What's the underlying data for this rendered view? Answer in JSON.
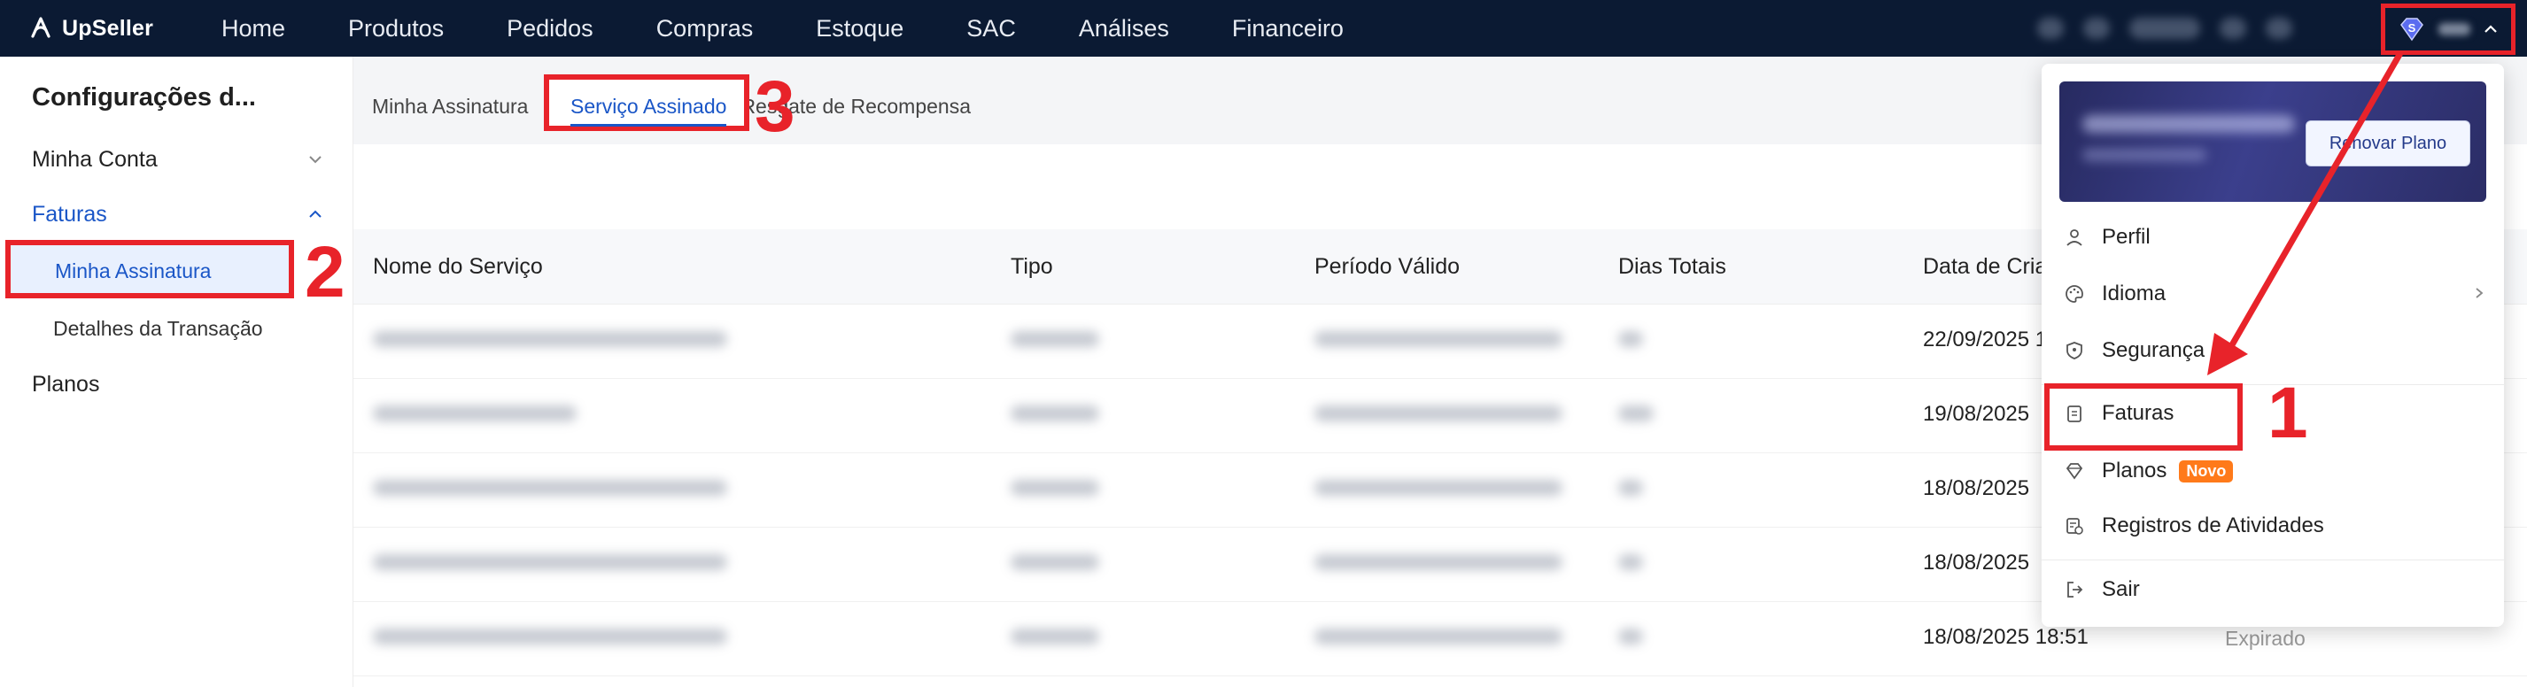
{
  "app": {
    "logo_text": "UpSeller"
  },
  "nav": [
    "Home",
    "Produtos",
    "Pedidos",
    "Compras",
    "Estoque",
    "SAC",
    "Análises",
    "Financeiro"
  ],
  "sidebar": {
    "title": "Configurações d...",
    "items": [
      {
        "label": "Minha Conta"
      },
      {
        "label": "Faturas"
      },
      {
        "label": "Minha Assinatura"
      },
      {
        "label": "Detalhes da Transação"
      },
      {
        "label": "Planos"
      }
    ]
  },
  "tabs": [
    "Minha Assinatura",
    "Serviço Assinado",
    "Resgate de Recompensa"
  ],
  "table": {
    "columns": [
      "Nome do Serviço",
      "Tipo",
      "Período Válido",
      "Dias Totais",
      "Data de Cria"
    ],
    "rows": [
      {
        "date": "22/09/2025 1"
      },
      {
        "date": "19/08/2025"
      },
      {
        "date": "18/08/2025"
      },
      {
        "date": "18/08/2025"
      },
      {
        "date": "18/08/2025 18:51",
        "status": "Expirado"
      }
    ]
  },
  "dropdown": {
    "renew_label": "Renovar Plano",
    "items": [
      "Perfil",
      "Idioma",
      "Segurança",
      "Faturas",
      "Planos",
      "Registros de Atividades",
      "Sair"
    ],
    "new_badge": "Novo"
  },
  "annotations": [
    "1",
    "2",
    "3"
  ],
  "colors": {
    "topbar": "#0b1a33",
    "accent": "#1a56c7",
    "highlight": "#e8232a",
    "badge": "#ff7a1a"
  }
}
